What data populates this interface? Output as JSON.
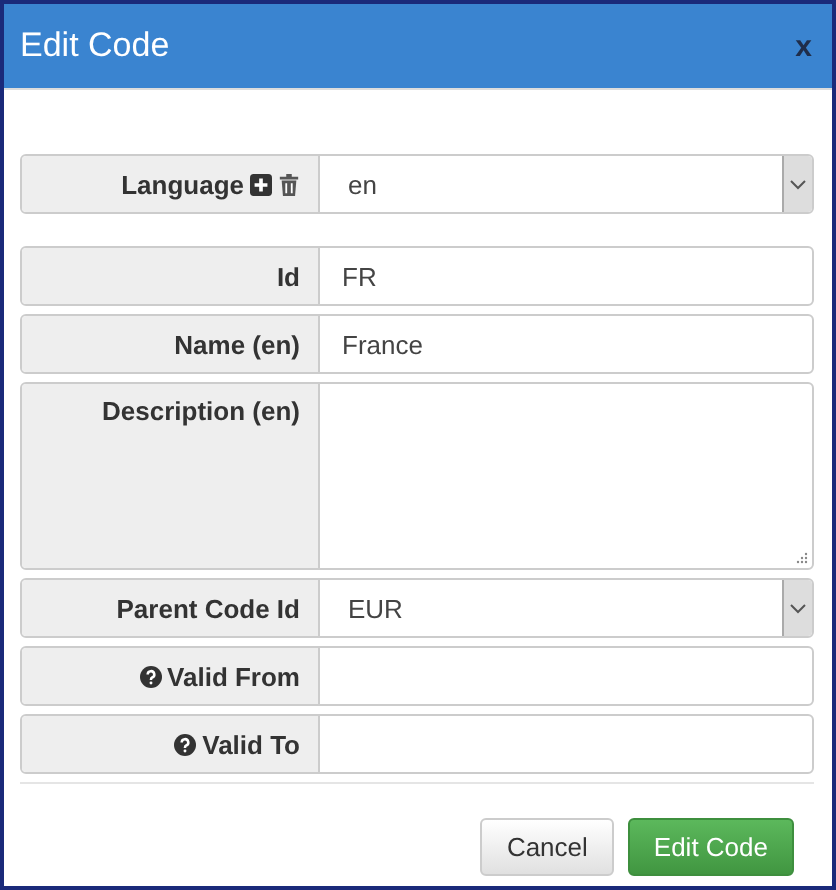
{
  "dialog": {
    "title": "Edit Code",
    "close": "x"
  },
  "language": {
    "label": "Language",
    "kind": "select",
    "value": "en",
    "actions": true,
    "help": false
  },
  "fields": [
    {
      "label": "Id",
      "kind": "text",
      "value": "FR",
      "actions": false,
      "help": false
    },
    {
      "label": "Name (en)",
      "kind": "text",
      "value": "France",
      "actions": false,
      "help": false
    },
    {
      "label": "Description (en)",
      "kind": "textarea",
      "actions": false,
      "help": false
    },
    {
      "label": "Parent Code Id",
      "kind": "select",
      "value": "EUR",
      "actions": false,
      "help": false
    },
    {
      "label": "Valid From",
      "kind": "text",
      "actions": false,
      "help": true
    },
    {
      "label": "Valid To",
      "kind": "text",
      "actions": false,
      "help": true
    }
  ],
  "buttons": [
    {
      "label": "Cancel",
      "kind": "default"
    },
    {
      "label": "Edit Code",
      "kind": "primary"
    }
  ]
}
